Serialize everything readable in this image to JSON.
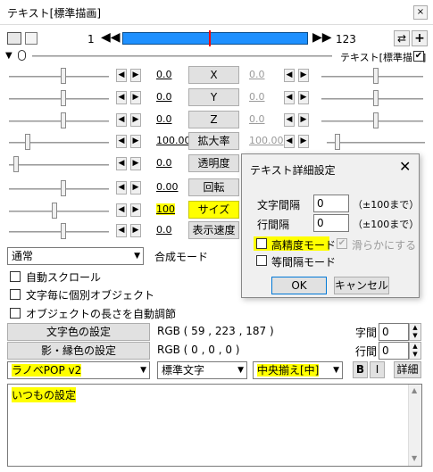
{
  "window": {
    "title": "テキスト[標準描画]",
    "close_icon": "×"
  },
  "timeline": {
    "start": "1",
    "end": "123",
    "plus_icon": "+",
    "arrow_icon": "⇄"
  },
  "object_label": "テキスト[標準描画]",
  "params": [
    {
      "name": "X",
      "value": "0.0",
      "value2": "0.0"
    },
    {
      "name": "Y",
      "value": "0.0",
      "value2": "0.0"
    },
    {
      "name": "Z",
      "value": "0.0",
      "value2": "0.0"
    },
    {
      "name": "拡大率",
      "value": "100.00",
      "value2": "100.00"
    },
    {
      "name": "透明度",
      "value": "0.0",
      "value2": ""
    },
    {
      "name": "回転",
      "value": "0.00",
      "value2": ""
    },
    {
      "name": "サイズ",
      "value": "100",
      "value2": ""
    },
    {
      "name": "表示速度",
      "value": "0.0",
      "value2": ""
    }
  ],
  "blend": {
    "value": "通常",
    "label": "合成モード"
  },
  "checkboxes": [
    "自動スクロール",
    "文字毎に個別オブジェクト",
    "オブジェクトの長さを自動調節"
  ],
  "color": {
    "button": "文字色の設定",
    "value": "RGB ( 59 , 223 , 187 )"
  },
  "shadow": {
    "button": "影・縁色の設定",
    "value": "RGB ( 0 , 0 , 0 )"
  },
  "spacing": {
    "char_label": "字間",
    "char_value": "0",
    "line_label": "行間",
    "line_value": "0"
  },
  "font": {
    "value": "ラノベPOP v2"
  },
  "style": {
    "value": "標準文字"
  },
  "align": {
    "value": "中央揃え[中]"
  },
  "format_buttons": {
    "bold": "B",
    "italic": "I",
    "detail": "詳細"
  },
  "text_content": "いつもの設定",
  "dialog": {
    "title": "テキスト詳細設定",
    "char_spacing_label": "文字間隔",
    "char_spacing_value": "0",
    "char_spacing_range": "（±100まで）",
    "line_spacing_label": "行間隔",
    "line_spacing_value": "0",
    "line_spacing_range": "（±100まで）",
    "high_precision": "高精度モード",
    "smooth": "滑らかにする",
    "equal_spacing": "等間隔モード",
    "ok": "OK",
    "cancel": "キャンセル"
  },
  "colors": {
    "highlight": "#ffff00",
    "timeline_bar": "#1e90ff",
    "marker": "#ff0000"
  }
}
